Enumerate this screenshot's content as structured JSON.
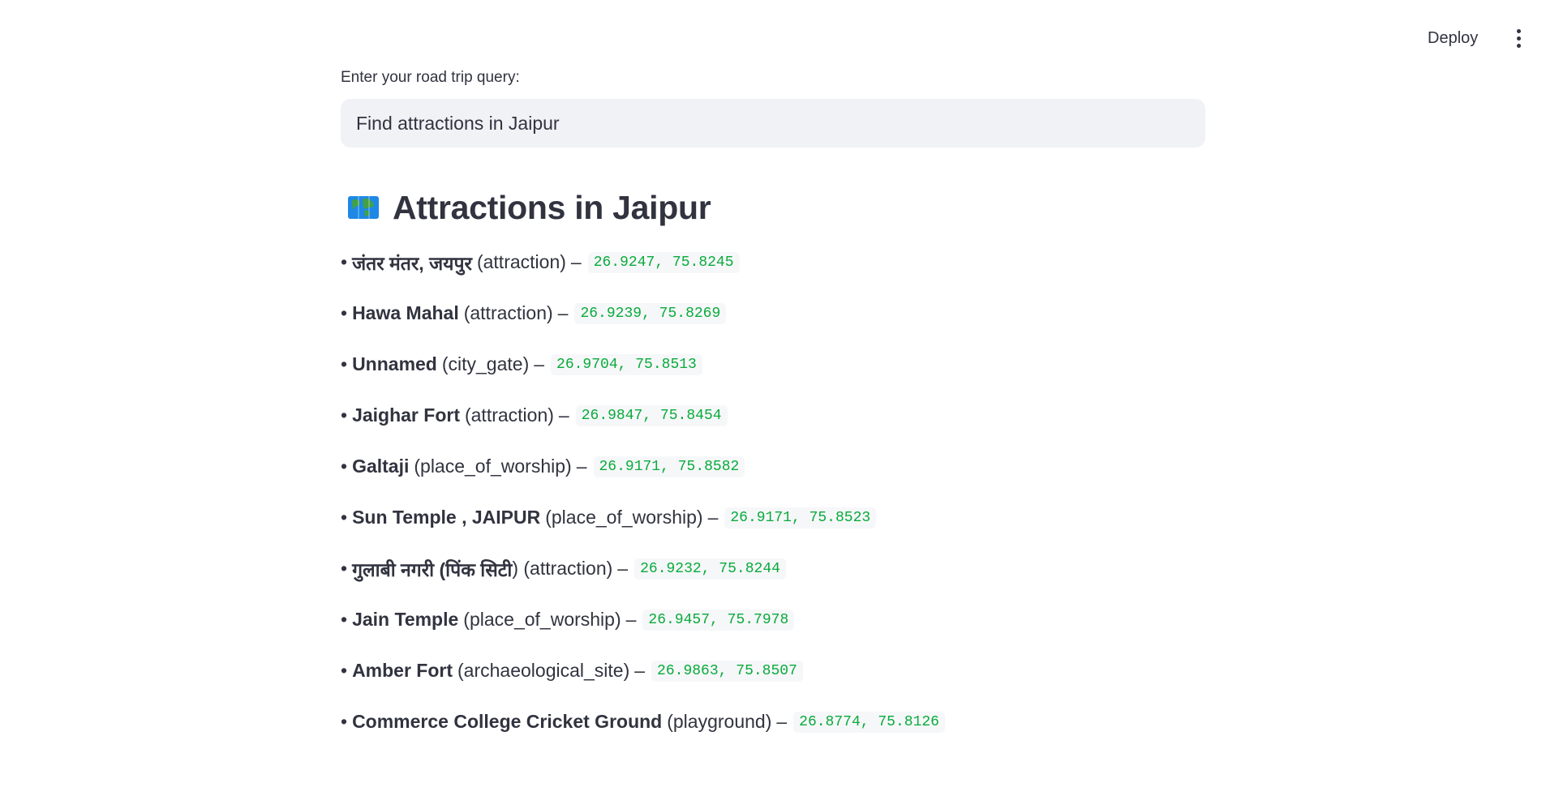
{
  "header": {
    "deploy_label": "Deploy",
    "menu_icon": "vertical-ellipsis-icon"
  },
  "query": {
    "label": "Enter your road trip query:",
    "value": "Find attractions in Jaipur"
  },
  "results": {
    "icon": "world-map-icon",
    "heading": "Attractions in Jaipur",
    "items": [
      {
        "bullet": "•",
        "name": "जंतर मंतर, जयपुर",
        "category": "(attraction)",
        "dash": "–",
        "coords": "26.9247, 75.8245"
      },
      {
        "bullet": "•",
        "name": "Hawa Mahal",
        "category": "(attraction)",
        "dash": "–",
        "coords": "26.9239, 75.8269"
      },
      {
        "bullet": "•",
        "name": "Unnamed",
        "category": "(city_gate)",
        "dash": "–",
        "coords": "26.9704, 75.8513"
      },
      {
        "bullet": "•",
        "name": "Jaighar Fort",
        "category": "(attraction)",
        "dash": "–",
        "coords": "26.9847, 75.8454"
      },
      {
        "bullet": "•",
        "name": "Galtaji",
        "category": "(place_of_worship)",
        "dash": "–",
        "coords": "26.9171, 75.8582"
      },
      {
        "bullet": "•",
        "name": "Sun Temple , JAIPUR",
        "category": "(place_of_worship)",
        "dash": "–",
        "coords": "26.9171, 75.8523"
      },
      {
        "bullet": "•",
        "name": "गुलाबी नगरी (पिंक सिटी",
        "category": ") (attraction)",
        "dash": "–",
        "coords": "26.9232, 75.8244"
      },
      {
        "bullet": "•",
        "name": "Jain Temple",
        "category": "(place_of_worship)",
        "dash": "–",
        "coords": "26.9457, 75.7978"
      },
      {
        "bullet": "•",
        "name": "Amber Fort",
        "category": "(archaeological_site)",
        "dash": "–",
        "coords": "26.9863, 75.8507"
      },
      {
        "bullet": "•",
        "name": "Commerce College Cricket Ground",
        "category": "(playground)",
        "dash": "–",
        "coords": "26.8774, 75.8126"
      }
    ]
  },
  "colors": {
    "text": "#31333f",
    "input_bg": "#f0f2f6",
    "code_green": "#09ab3b",
    "code_bg": "#f6f7f9"
  }
}
